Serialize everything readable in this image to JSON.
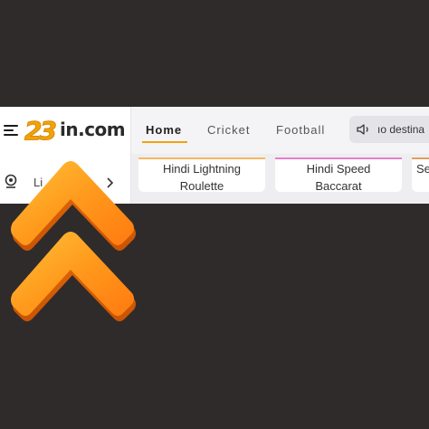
{
  "header": {
    "logo_mark": "23",
    "logo_text": "in.com",
    "tabs": [
      {
        "label": "Home",
        "active": true
      },
      {
        "label": "Cricket",
        "active": false
      },
      {
        "label": "Football",
        "active": false
      }
    ],
    "announcement": "ıo destina"
  },
  "sidebar": {
    "live_label": "Li"
  },
  "game_cards": [
    {
      "line1": "Hindi Lightning",
      "line2": "Roulette"
    },
    {
      "line1": "Hindi Speed",
      "line2": "Baccarat"
    },
    {
      "line1": "Se",
      "line2": ""
    }
  ],
  "colors": {
    "accent": "#f2a20c",
    "page_bg": "#2f2b2b",
    "arrow_orange": "#ff8a12"
  },
  "icons": [
    "menu-icon",
    "speaker-icon",
    "live-icon",
    "chevron-right-icon",
    "double-chevron-up-icon"
  ]
}
